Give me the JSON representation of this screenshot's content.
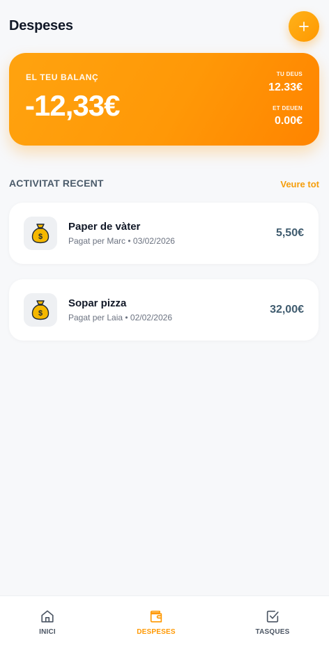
{
  "header": {
    "title": "Despeses",
    "add_icon": "plus-icon"
  },
  "balance": {
    "label": "EL TEU BALANÇ",
    "value": "-12,33€",
    "owe_label": "TU DEUS",
    "owe_value": "12.33€",
    "owed_label": "ET DEUEN",
    "owed_value": "0.00€"
  },
  "recent": {
    "title": "ACTIVITAT RECENT",
    "see_all": "Veure tot",
    "items": [
      {
        "icon": "money-bag-icon",
        "title": "Paper de vàter",
        "meta": "Pagat per Marc • 03/02/2026",
        "amount": "5,50€"
      },
      {
        "icon": "money-bag-icon",
        "title": "Sopar pizza",
        "meta": "Pagat per Laia • 02/02/2026",
        "amount": "32,00€"
      }
    ]
  },
  "nav": {
    "items": [
      {
        "label": "INICI",
        "icon": "home-icon",
        "active": false
      },
      {
        "label": "DESPESES",
        "icon": "wallet-icon",
        "active": true
      },
      {
        "label": "TASQUES",
        "icon": "checkbox-icon",
        "active": false
      }
    ]
  },
  "colors": {
    "accent": "#FF9800",
    "inactive": "#4B5563",
    "amount": "#3F5B6E"
  }
}
